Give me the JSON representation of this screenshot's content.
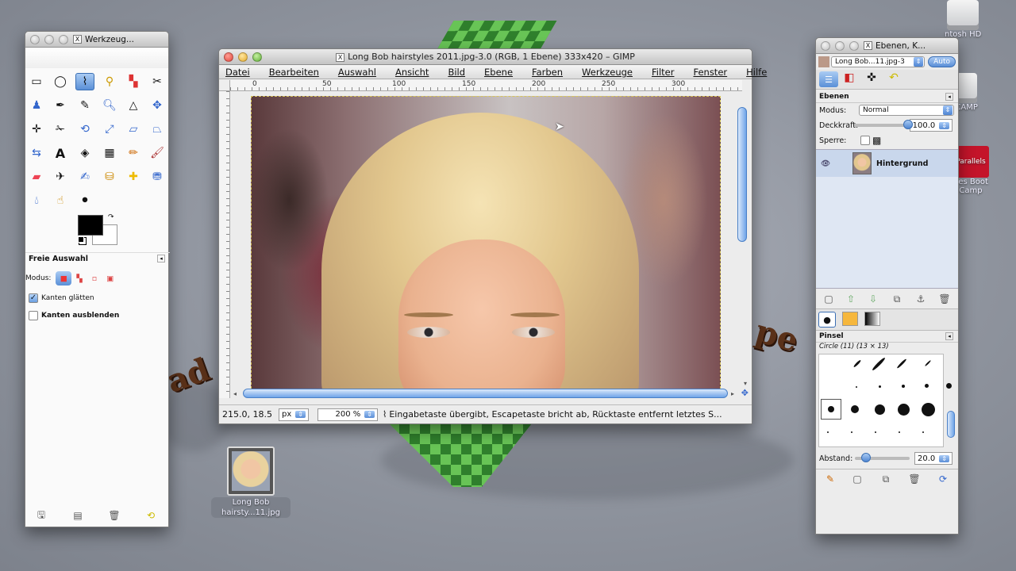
{
  "desktop": {
    "icons": [
      {
        "label": "ntosh HD"
      },
      {
        "label": "OTCAMP"
      },
      {
        "label": "Parallels"
      },
      {
        "label": "nes Boot"
      },
      {
        "label": "Camp"
      }
    ],
    "file_icon": {
      "label_line1": "Long Bob",
      "label_line2": "hairsty...11.jpg"
    }
  },
  "toolbox": {
    "title": "Werkzeug...",
    "tool_options_title": "Freie Auswahl",
    "mode_label": "Modus:",
    "antialias_label": "Kanten glätten",
    "antialias_checked": true,
    "feather_label": "Kanten ausblenden",
    "feather_checked": false,
    "fg_color": "#000000",
    "bg_color": "#ffffff"
  },
  "image_window": {
    "title": "Long Bob hairstyles 2011.jpg-3.0 (RGB, 1 Ebene) 333x420 – GIMP",
    "menu": [
      "Datei",
      "Bearbeiten",
      "Auswahl",
      "Ansicht",
      "Bild",
      "Ebene",
      "Farben",
      "Werkzeuge",
      "Filter",
      "Fenster",
      "Hilfe"
    ],
    "ruler_ticks": [
      "0",
      "50",
      "100",
      "150",
      "200",
      "250",
      "300"
    ],
    "status": {
      "coords": "215.0, 18.5",
      "unit": "px",
      "zoom": "200 %",
      "message": "Eingabetaste übergibt, Escapetaste bricht ab, Rücktaste entfernt letztes S..."
    }
  },
  "layers_dock": {
    "title": "Ebenen, K...",
    "image_select": "Long Bob...11.jpg-3",
    "auto_label": "Auto",
    "layers_header": "Ebenen",
    "mode_label": "Modus:",
    "mode_value": "Normal",
    "opacity_label": "Deckkraft:",
    "opacity_value": "100.0",
    "opacity_fraction": 1.0,
    "lock_label": "Sperre:",
    "layer_name": "Hintergrund",
    "brush_header": "Pinsel",
    "brush_name": "Circle (11) (13 × 13)",
    "spacing_label": "Abstand:",
    "spacing_value": "20.0"
  },
  "colors": {
    "accent": "#5a8fd7",
    "window_bg": "#ececec",
    "selected_layer": "#c9d7ec"
  }
}
